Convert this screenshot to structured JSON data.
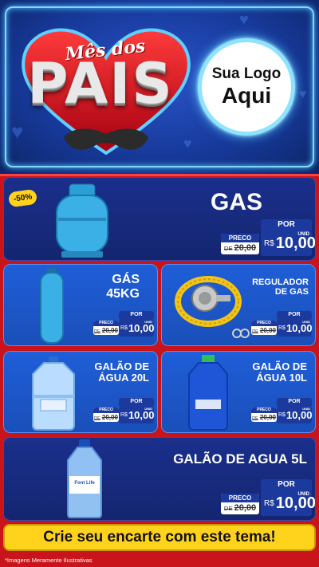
{
  "header": {
    "mes_dos": "Mês dos",
    "pais": "PAIS",
    "logo_line1": "Sua Logo",
    "logo_line2": "Aqui"
  },
  "colors": {
    "header_blue": "#1f46b8",
    "card_blue": "#1a2f8c",
    "red_background": "#c8141a",
    "yellow_accent": "#ffd21c"
  },
  "products": [
    {
      "name": "GAS",
      "badge": "-50%",
      "price_label": "PRECO",
      "old_prefix": "DE",
      "old_price": "20,00",
      "por_label": "POR",
      "currency": "R$",
      "price": "10,00",
      "unit": "UNID"
    },
    {
      "name_line1": "GÁS",
      "name_line2": "45KG",
      "price_label": "PRECO",
      "old_prefix": "DE",
      "old_price": "20,00",
      "por_label": "POR",
      "currency": "R$",
      "price": "10,00",
      "unit": "UNID"
    },
    {
      "name_line1": "REGULADOR",
      "name_line2": "DE GAS",
      "price_label": "PRECO",
      "old_prefix": "DE",
      "old_price": "20,00",
      "por_label": "POR",
      "currency": "R$",
      "price": "10,00",
      "unit": "UNID"
    },
    {
      "name_line1": "GALÃO DE",
      "name_line2": "ÁGUA 20L",
      "price_label": "PRECO",
      "old_prefix": "DE",
      "old_price": "20,00",
      "por_label": "POR",
      "currency": "R$",
      "price": "10,00",
      "unit": "UNID"
    },
    {
      "name_line1": "GALÃO DE",
      "name_line2": "ÁGUA 10L",
      "price_label": "PRECO",
      "old_prefix": "DE",
      "old_price": "20,00",
      "por_label": "POR",
      "currency": "R$",
      "price": "10,00",
      "unit": "UNID"
    },
    {
      "name": "GALÃO DE AGUA 5L",
      "bottle_label": "Font Life",
      "price_label": "PRECO",
      "old_prefix": "DE",
      "old_price": "20,00",
      "por_label": "POR",
      "currency": "R$",
      "price": "10,00",
      "unit": "UNID"
    }
  ],
  "banner": {
    "text": "Crie seu encarte com este tema!"
  },
  "disclaimer": "*Imagens Meramente Ilustrativas"
}
